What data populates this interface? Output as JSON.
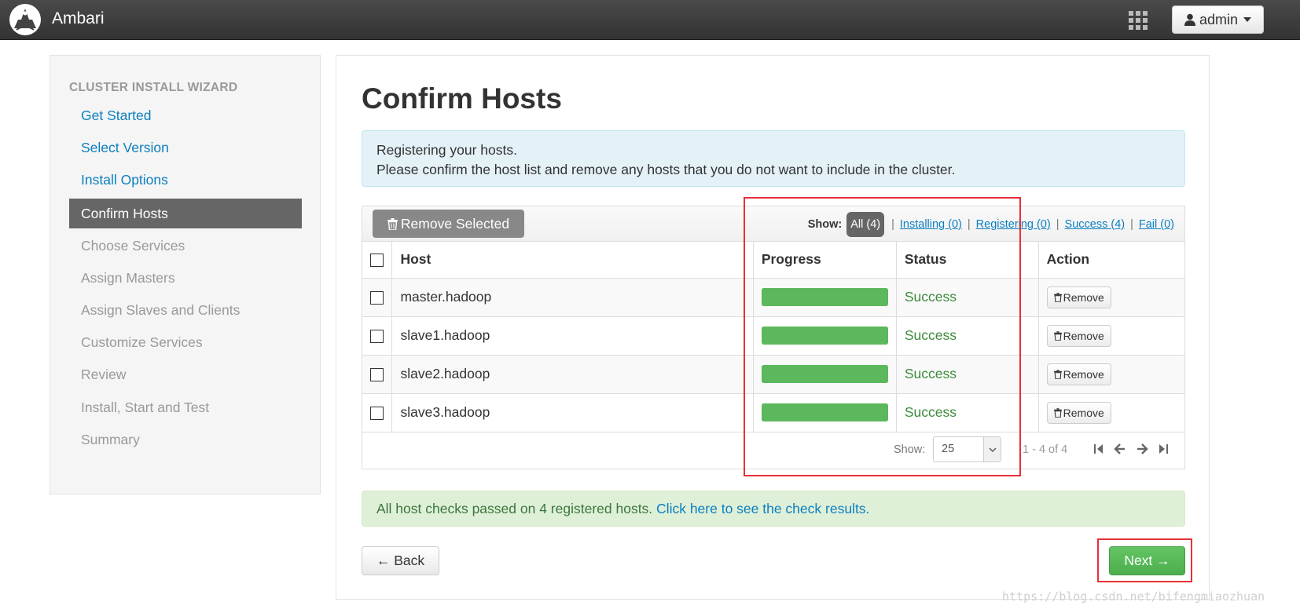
{
  "header": {
    "app_title": "Ambari",
    "apps_icon": "grid-icon",
    "user_label": "admin",
    "user_icon": "user-icon"
  },
  "sidebar": {
    "heading": "CLUSTER INSTALL WIZARD",
    "items": [
      {
        "label": "Get Started",
        "state": "link"
      },
      {
        "label": "Select Version",
        "state": "link"
      },
      {
        "label": "Install Options",
        "state": "link"
      },
      {
        "label": "Confirm Hosts",
        "state": "active"
      },
      {
        "label": "Choose Services",
        "state": "disabled"
      },
      {
        "label": "Assign Masters",
        "state": "disabled"
      },
      {
        "label": "Assign Slaves and Clients",
        "state": "disabled"
      },
      {
        "label": "Customize Services",
        "state": "disabled"
      },
      {
        "label": "Review",
        "state": "disabled"
      },
      {
        "label": "Install, Start and Test",
        "state": "disabled"
      },
      {
        "label": "Summary",
        "state": "disabled"
      }
    ]
  },
  "main": {
    "title": "Confirm Hosts",
    "info_line1": "Registering your hosts.",
    "info_line2": "Please confirm the host list and remove any hosts that you do not want to include in the cluster.",
    "remove_selected_label": "Remove Selected",
    "filters": {
      "show_label": "Show:",
      "all": "All (4)",
      "installing": "Installing (0)",
      "registering": "Registering (0)",
      "success": "Success (4)",
      "fail": "Fail (0)",
      "separator": "|"
    },
    "columns": [
      "Host",
      "Progress",
      "Status",
      "Action"
    ],
    "rows": [
      {
        "host": "master.hadoop",
        "progress": 1.0,
        "status": "Success",
        "action": "Remove"
      },
      {
        "host": "slave1.hadoop",
        "progress": 1.0,
        "status": "Success",
        "action": "Remove"
      },
      {
        "host": "slave2.hadoop",
        "progress": 1.0,
        "status": "Success",
        "action": "Remove"
      },
      {
        "host": "slave3.hadoop",
        "progress": 1.0,
        "status": "Success",
        "action": "Remove"
      }
    ],
    "pagination": {
      "show_label": "Show:",
      "page_size": "25",
      "info": "1 - 4 of 4"
    },
    "checks_text": "All host checks passed on 4 registered hosts.",
    "checks_link": "Click here to see the check results.",
    "back_label": "← Back",
    "next_label": "Next →"
  },
  "watermark": "https://blog.csdn.net/bifengmiaozhuan",
  "colors": {
    "topbar": "#333333",
    "link": "#0b7fc0",
    "success": "#5cb85c",
    "annotation": "#e8303a"
  }
}
